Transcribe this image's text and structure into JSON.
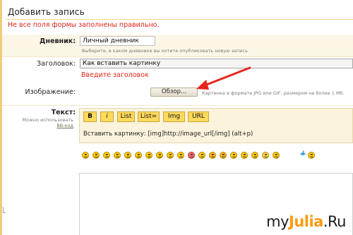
{
  "page": {
    "title": "Добавить запись",
    "error_banner": "Не все поля формы заполнены правильно."
  },
  "diary": {
    "label": "Дневник:",
    "value": "Личный дневник",
    "hint": "Выберите, в каком дневнике вы хотите опубликовать новую запись"
  },
  "subject": {
    "label": "Заголовок:",
    "value": "Как вставить картинку",
    "error": "Введите заголовок"
  },
  "image": {
    "label": "Изображение:",
    "browse_label": "Обзор...",
    "hint": "Картинка в формате JPG или GIF, размером не более 1 Мб."
  },
  "text": {
    "label": "Текст:",
    "subhint_line1": "Можно использовать",
    "subhint_link": "BB-код",
    "toolbar": [
      "B",
      "i",
      "List",
      "List=",
      "Img",
      "URL"
    ],
    "insert_hint": "Вставить картинку: [img]http://image_url[/img]  (alt+p)"
  },
  "smileys": [
    "smile-icon",
    "wink-icon",
    "grin-icon",
    "neutral-icon",
    "sad-icon",
    "tongue-icon",
    "squint-icon",
    "laugh-icon",
    "cool-icon",
    "blush-icon",
    "red-face-icon",
    "surprised-icon",
    "angry-icon",
    "devil-icon",
    "cat-icon",
    "nerd-icon",
    "kiss-icon",
    "eek-icon",
    "question-icon",
    "bird-icon",
    "rolleyes-icon"
  ],
  "watermark": {
    "prefix": "my",
    "accent": "Julia",
    "suffix": ".Ru"
  },
  "colors": {
    "accent_yellow": "#ffd95c",
    "error_red": "#e0241a",
    "arrow_red": "#e8261c",
    "brand_orange": "#ff9b12"
  }
}
